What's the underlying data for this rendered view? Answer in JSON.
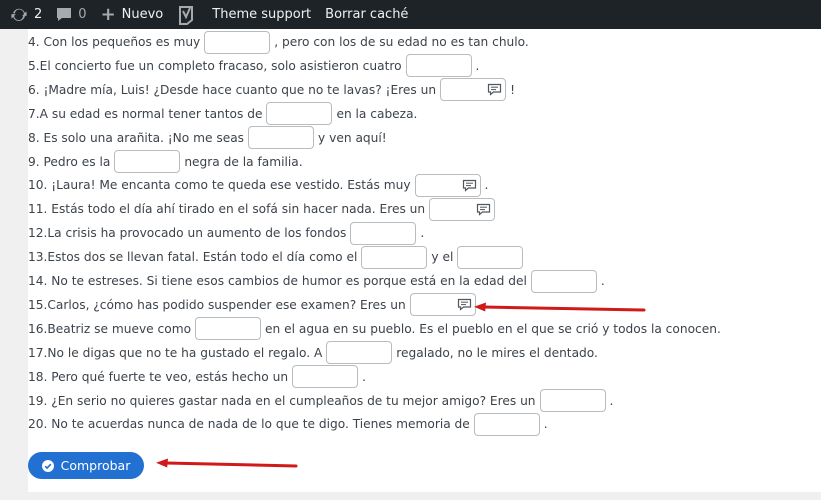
{
  "adminbar": {
    "updates_count": "2",
    "comments_count": "0",
    "new_label": "Nuevo",
    "theme_support_label": "Theme support",
    "clear_cache_label": "Borrar caché"
  },
  "questions": [
    {
      "before": "4. Con los pequeños es muy",
      "after": ", pero con los de su edad no es tan chulo.",
      "value": "",
      "hint": false
    },
    {
      "before": "5.El concierto fue un completo fracaso, solo asistieron cuatro",
      "after": ".",
      "value": "",
      "hint": false
    },
    {
      "before": "6. ¡Madre mía, Luis! ¿Desde hace cuanto que no te lavas? ¡Eres un",
      "after": "!",
      "value": "",
      "hint": true
    },
    {
      "before": "7.A su edad es normal tener tantos de",
      "after": "en la cabeza.",
      "value": "",
      "hint": false
    },
    {
      "before": "8. Es solo una arañita. ¡No me seas",
      "after": "y ven aquí!",
      "value": "",
      "hint": false
    },
    {
      "before": "9. Pedro es la",
      "after": "negra de la familia.",
      "value": "",
      "hint": false
    },
    {
      "before": "10. ¡Laura! Me encanta como te queda ese vestido. Estás muy",
      "after": ".",
      "value": "",
      "hint": true
    },
    {
      "before": "11. Estás todo el día ahí tirado en el sofá sin hacer nada. Eres un",
      "after": "",
      "value": "",
      "hint": true
    },
    {
      "before": "12.La crisis ha provocado un aumento de los fondos",
      "after": ".",
      "value": "",
      "hint": false
    },
    {
      "before": "13.Estos dos se llevan fatal. Están todo el día como el",
      "middle": "y el",
      "after": "",
      "value": "",
      "hint": false
    },
    {
      "before": "14. No te estreses. Si tiene esos cambios de humor es porque está en la edad del",
      "after": ".",
      "value": "",
      "hint": false
    },
    {
      "before": "15.Carlos, ¿cómo has podido suspender ese examen? Eres un",
      "after": ".",
      "value": "",
      "hint": true
    },
    {
      "before": "16.Beatriz se mueve como",
      "after": "en el agua en su pueblo. Es el pueblo en el que se crió y todos la conocen.",
      "value": "",
      "hint": false
    },
    {
      "before": "17.No le digas que no te ha gustado el regalo. A",
      "after": "regalado, no le mires el dentado.",
      "value": "",
      "hint": false
    },
    {
      "before": "18. Pero qué fuerte te veo, estás hecho un",
      "after": ".",
      "value": "",
      "hint": false
    },
    {
      "before": "19. ¿En serio no quieres gastar nada en el cumpleaños de tu mejor amigo? Eres un",
      "after": ".",
      "value": "",
      "hint": false
    },
    {
      "before": "20. No te acuerdas nunca de nada de lo que te digo. Tienes memoria de",
      "after": ".",
      "value": "",
      "hint": false
    }
  ],
  "check_button": {
    "label": "Comprobar"
  },
  "colors": {
    "adminbar": "#1d2327",
    "button": "#2271d2",
    "arrow": "#d01919"
  }
}
